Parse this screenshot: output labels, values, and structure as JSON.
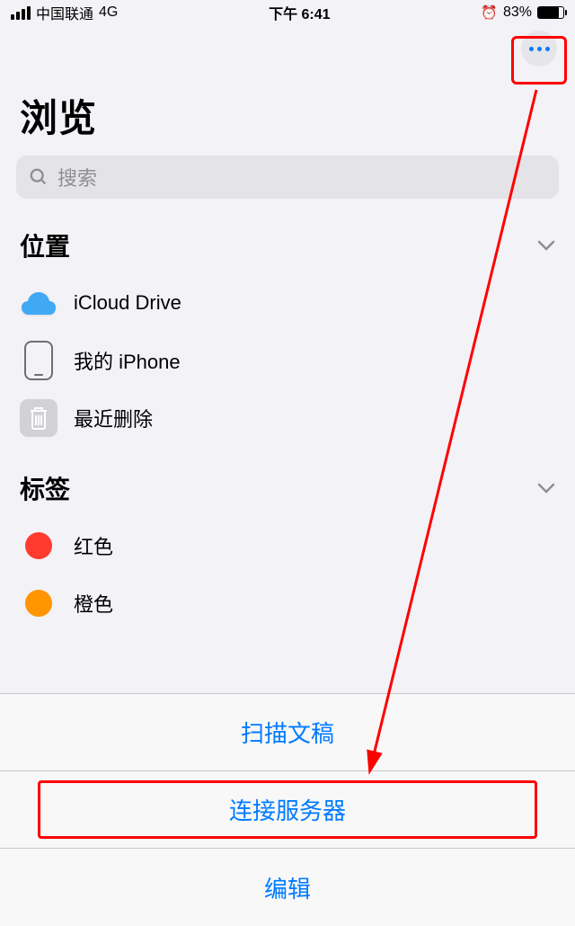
{
  "statusBar": {
    "carrier": "中国联通",
    "network": "4G",
    "time": "下午 6:41",
    "batteryPercent": "83%",
    "batteryLevel": 83
  },
  "page": {
    "title": "浏览"
  },
  "search": {
    "placeholder": "搜索"
  },
  "sections": {
    "locations": {
      "title": "位置",
      "items": [
        {
          "label": "iCloud Drive"
        },
        {
          "label": "我的 iPhone"
        },
        {
          "label": "最近删除"
        }
      ]
    },
    "tags": {
      "title": "标签",
      "items": [
        {
          "label": "红色",
          "color": "#ff3b30"
        },
        {
          "label": "橙色",
          "color": "#ff9500"
        }
      ]
    }
  },
  "actionSheet": {
    "items": [
      {
        "label": "扫描文稿"
      },
      {
        "label": "连接服务器"
      },
      {
        "label": "编辑"
      }
    ]
  }
}
